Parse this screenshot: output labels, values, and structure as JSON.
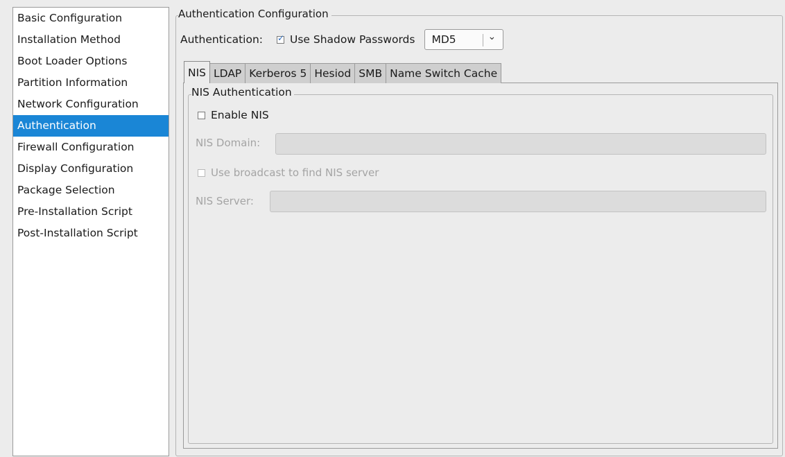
{
  "sidebar": {
    "items": [
      {
        "label": "Basic Configuration"
      },
      {
        "label": "Installation Method"
      },
      {
        "label": "Boot Loader Options"
      },
      {
        "label": "Partition Information"
      },
      {
        "label": "Network Configuration"
      },
      {
        "label": "Authentication",
        "selected": true
      },
      {
        "label": "Firewall Configuration"
      },
      {
        "label": "Display Configuration"
      },
      {
        "label": "Package Selection"
      },
      {
        "label": "Pre-Installation Script"
      },
      {
        "label": "Post-Installation Script"
      }
    ]
  },
  "auth": {
    "frame_title": "Authentication Configuration",
    "label": "Authentication:",
    "shadow_passwords": {
      "label": "Use Shadow Passwords",
      "checked": true
    },
    "hash_select": {
      "value": "MD5"
    }
  },
  "tabs": [
    {
      "label": "NIS",
      "active": true
    },
    {
      "label": "LDAP"
    },
    {
      "label": "Kerberos 5"
    },
    {
      "label": "Hesiod"
    },
    {
      "label": "SMB"
    },
    {
      "label": "Name Switch Cache"
    }
  ],
  "nis": {
    "frame_title": "NIS Authentication",
    "enable": {
      "label": "Enable NIS",
      "checked": false
    },
    "domain": {
      "label": "NIS Domain:",
      "value": ""
    },
    "broadcast": {
      "label": "Use broadcast to find NIS server",
      "checked": false
    },
    "server": {
      "label": "NIS Server:",
      "value": ""
    }
  },
  "colors": {
    "selection": "#1a86d6",
    "disabled_text": "#a4a4a4",
    "window_bg": "#ececec"
  }
}
